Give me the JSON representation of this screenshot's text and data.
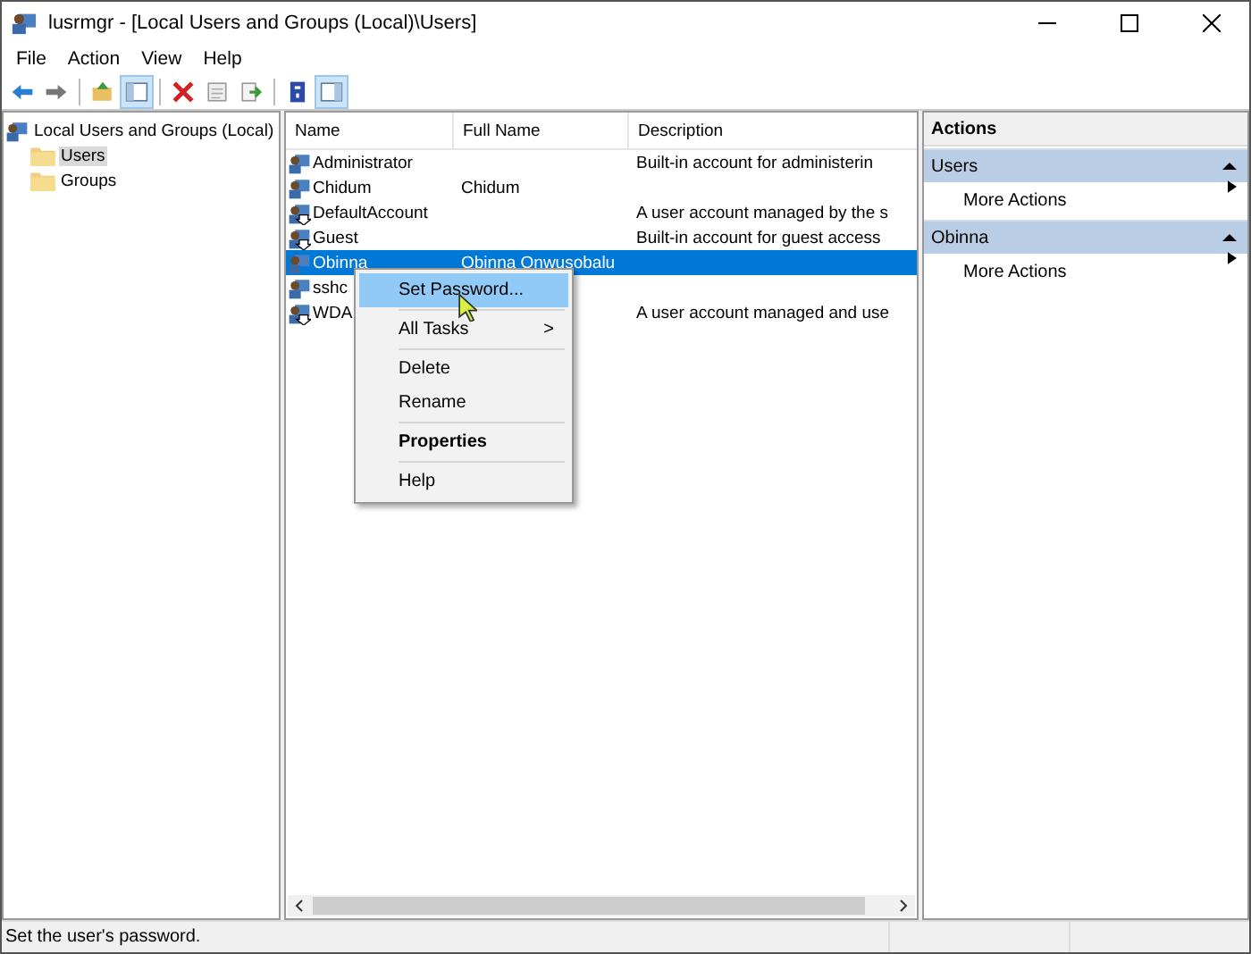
{
  "window": {
    "title": "lusrmgr - [Local Users and Groups (Local)\\Users]"
  },
  "menu": [
    "File",
    "Action",
    "View",
    "Help"
  ],
  "toolbar": [
    {
      "kind": "back",
      "pressed": false
    },
    {
      "kind": "forward",
      "pressed": false
    },
    {
      "kind": "sep"
    },
    {
      "kind": "up",
      "pressed": false
    },
    {
      "kind": "tree",
      "pressed": true
    },
    {
      "kind": "sep"
    },
    {
      "kind": "delete",
      "pressed": false
    },
    {
      "kind": "properties",
      "pressed": false
    },
    {
      "kind": "export",
      "pressed": false
    },
    {
      "kind": "sep"
    },
    {
      "kind": "help",
      "pressed": false
    },
    {
      "kind": "pane",
      "pressed": true
    }
  ],
  "tree": {
    "label": "Local Users and Groups (Local)",
    "children": [
      {
        "label": "Users",
        "selected": true
      },
      {
        "label": "Groups",
        "selected": false
      }
    ]
  },
  "table": {
    "columns": [
      "Name",
      "Full Name",
      "Description"
    ],
    "rows": [
      {
        "name": "Administrator",
        "full_name": "",
        "description": "Built-in account for administerin",
        "disabled": false,
        "selected": false
      },
      {
        "name": "Chidum",
        "full_name": "Chidum",
        "description": "",
        "disabled": false,
        "selected": false
      },
      {
        "name": "DefaultAccount",
        "full_name": "",
        "description": "A user account managed by the s",
        "disabled": true,
        "selected": false
      },
      {
        "name": "Guest",
        "full_name": "",
        "description": "Built-in account for guest access",
        "disabled": true,
        "selected": false
      },
      {
        "name": "Obinna",
        "full_name": "Obinna Onwusobalu",
        "description": "",
        "disabled": false,
        "selected": true
      },
      {
        "name": "sshc",
        "full_name": "",
        "description": "",
        "disabled": false,
        "selected": false
      },
      {
        "name": "WDA",
        "full_name": "",
        "description": "A user account managed and use",
        "disabled": true,
        "selected": false
      }
    ]
  },
  "context_menu": [
    {
      "kind": "item",
      "label": "Set Password...",
      "selected": true,
      "default": false
    },
    {
      "kind": "separator"
    },
    {
      "kind": "item",
      "label": "All Tasks",
      "arrow": ">",
      "selected": false,
      "default": false
    },
    {
      "kind": "separator"
    },
    {
      "kind": "item",
      "label": "Delete",
      "selected": false,
      "default": false
    },
    {
      "kind": "item",
      "label": "Rename",
      "selected": false,
      "default": false
    },
    {
      "kind": "separator"
    },
    {
      "kind": "item",
      "label": "Properties",
      "selected": false,
      "default": true
    },
    {
      "kind": "separator"
    },
    {
      "kind": "item",
      "label": "Help",
      "selected": false,
      "default": false
    }
  ],
  "actions": {
    "title": "Actions",
    "sections": [
      {
        "header": "Users",
        "expanded": true,
        "items": [
          "More Actions"
        ]
      },
      {
        "header": "Obinna",
        "expanded": true,
        "items": [
          "More Actions"
        ]
      }
    ]
  },
  "status_bar": "Set the user's password."
}
